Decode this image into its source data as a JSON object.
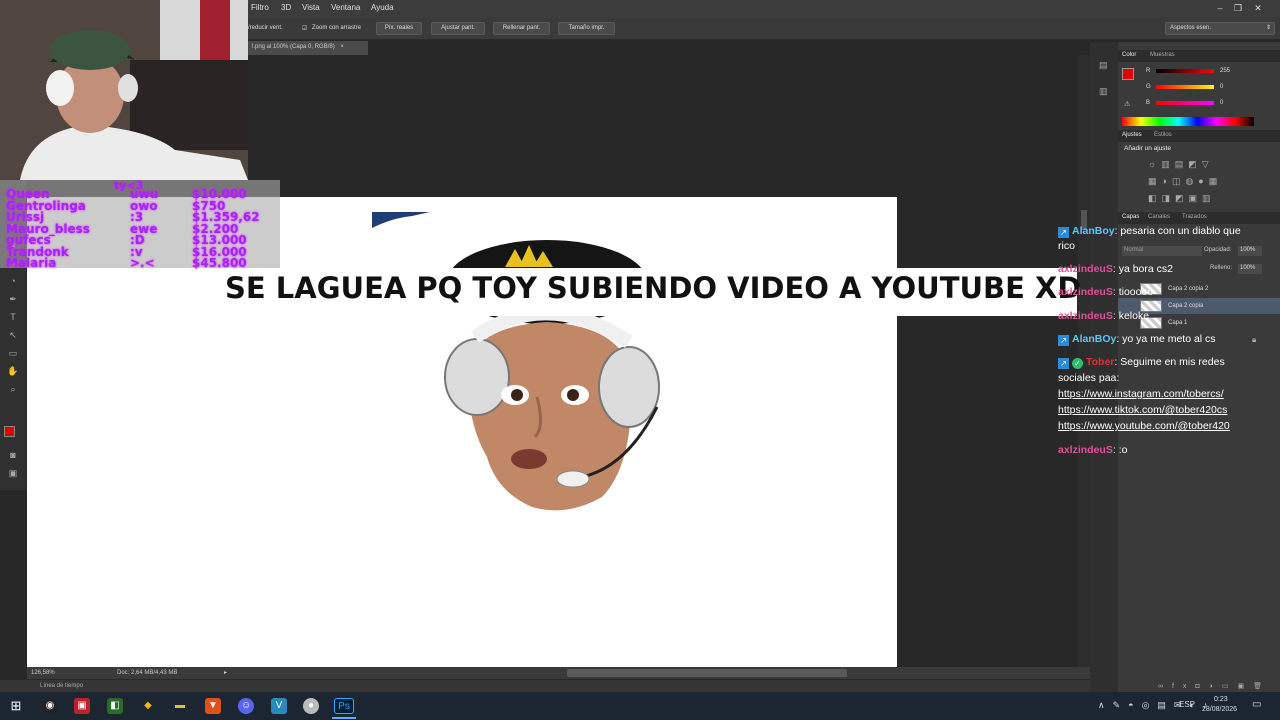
{
  "menu": {
    "items": [
      "Filtro",
      "3D",
      "Vista",
      "Ventana",
      "Ayuda"
    ]
  },
  "options_bar": {
    "resize_label": "/reducir vent.",
    "zoom_drag_label": "Zoom con arrastre",
    "buttons": [
      "Píx. reales",
      "Ajustar pant.",
      "Rellenar pant.",
      "Tamaño impr."
    ],
    "workspace": "Aspectos esen."
  },
  "document_tab": "l.png al 100% (Capa 0, RGB/8)",
  "status": {
    "zoom": "126,58%",
    "doc_info": "Doc: 2,64 MB/4,43 MB",
    "timeline": "Línea de tiempo"
  },
  "color_panel": {
    "tabs": [
      "Color",
      "Muestras"
    ],
    "r_label": "R",
    "g_label": "G",
    "b_label": "B",
    "r_value": "255",
    "g_value": "0",
    "b_value": "0",
    "foreground_color": "#e00000"
  },
  "adjustments_panel": {
    "tabs": [
      "Ajustes",
      "Estilos"
    ],
    "title": "Añadir un ajuste"
  },
  "layers_panel": {
    "tabs": [
      "Capas",
      "Canales",
      "Trazados"
    ],
    "blend_mode": "Normal",
    "opacity_label": "Opacidad:",
    "opacity": "100%",
    "fill_label": "Relleno:",
    "fill": "100%",
    "layers": [
      "Capa 2 copia 2",
      "Capa 2 copia",
      "Capa 1"
    ]
  },
  "donations": {
    "header": "ty<3",
    "rows": [
      {
        "name": "Queen",
        "msg": "uwu",
        "amount": "$10.000"
      },
      {
        "name": "Gentrolinga",
        "msg": "owo",
        "amount": "$750"
      },
      {
        "name": "Urissj",
        "msg": ":3",
        "amount": "$1.359,62"
      },
      {
        "name": "Mauro_bless",
        "msg": "ewe",
        "amount": "$2.200"
      },
      {
        "name": "gufecs",
        "msg": ":D",
        "amount": "$13.000"
      },
      {
        "name": "Trandonk",
        "msg": ":v",
        "amount": "$16.000"
      },
      {
        "name": "Malaria",
        "msg": ">.<",
        "amount": "$45.800"
      }
    ]
  },
  "banner": "SE LAGUEA PQ TOY SUBIENDO VIDEO A YOUTUBE XD",
  "chat": [
    {
      "user": "AlanBoy",
      "text": ": pesaria con un diablo que",
      "color": "#5bc8f5"
    },
    {
      "user": "",
      "text": "rico",
      "color": "#ffffff"
    },
    {
      "user": "axlzindeuS",
      "text": ": ya bora cs2",
      "color": "#e0509c"
    },
    {
      "user": "axlzindeuS",
      "text": ": tiooooo",
      "color": "#e0509c"
    },
    {
      "user": "axlzindeuS",
      "text": ": keloke",
      "color": "#e0509c"
    },
    {
      "user": "AlanBOy",
      "text": ": yo ya me meto al cs",
      "color": "#5bc8f5"
    },
    {
      "user": "Tober",
      "text": ": Seguime en mis redes",
      "color": "#e03030"
    },
    {
      "user": "",
      "text": "sociales paa:",
      "color": "#ffffff"
    },
    {
      "user": "",
      "text": "https://www.instagram.com/tobercs/",
      "color": "#ffffff"
    },
    {
      "user": "",
      "text": "https://www.tiktok.com/@tober420cs",
      "color": "#ffffff"
    },
    {
      "user": "",
      "text": "https://www.youtube.com/@tober420",
      "color": "#ffffff"
    },
    {
      "user": "axlzindeuS",
      "text": ": :o",
      "color": "#e0509c"
    }
  ],
  "taskbar": {
    "language": "ESP",
    "time": "0:23",
    "date": "28/08/2026"
  }
}
